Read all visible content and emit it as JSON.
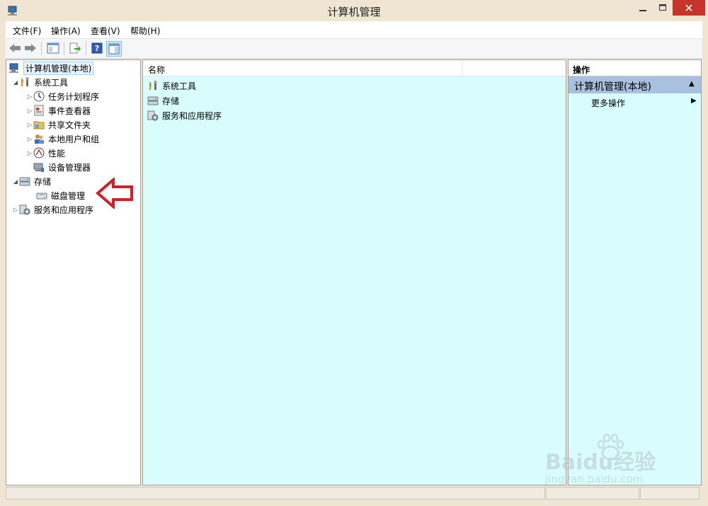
{
  "window": {
    "title": "计算机管理",
    "minimize_icon": "minimize-icon",
    "maximize_icon": "maximize-icon",
    "close_label": "✕"
  },
  "menu": {
    "items": [
      {
        "label": "文件(F)"
      },
      {
        "label": "操作(A)"
      },
      {
        "label": "查看(V)"
      },
      {
        "label": "帮助(H)"
      }
    ]
  },
  "toolbar": {
    "buttons": [
      "back-icon",
      "forward-icon",
      "show-hide-tree-icon",
      "export-list-icon",
      "help-icon",
      "show-hide-action-pane-icon"
    ]
  },
  "tree": {
    "root": "计算机管理(本地)",
    "items": [
      {
        "label": "系统工具"
      },
      {
        "label": "任务计划程序"
      },
      {
        "label": "事件查看器"
      },
      {
        "label": "共享文件夹"
      },
      {
        "label": "本地用户和组"
      },
      {
        "label": "性能"
      },
      {
        "label": "设备管理器"
      },
      {
        "label": "存储"
      },
      {
        "label": "磁盘管理"
      },
      {
        "label": "服务和应用程序"
      }
    ]
  },
  "list": {
    "column_name": "名称",
    "rows": [
      {
        "label": "系统工具"
      },
      {
        "label": "存储"
      },
      {
        "label": "服务和应用程序"
      }
    ]
  },
  "actions": {
    "header": "操作",
    "section": "计算机管理(本地)",
    "more": "更多操作"
  },
  "watermark": {
    "brand_text": "Baidu经验",
    "url_text": "jingyan.baidu.com"
  },
  "colors": {
    "accent_red_arrow": "#d0202a",
    "pane_background": "#d9fdfc",
    "action_section": "#a9c1de",
    "close_button": "#c7342a"
  }
}
